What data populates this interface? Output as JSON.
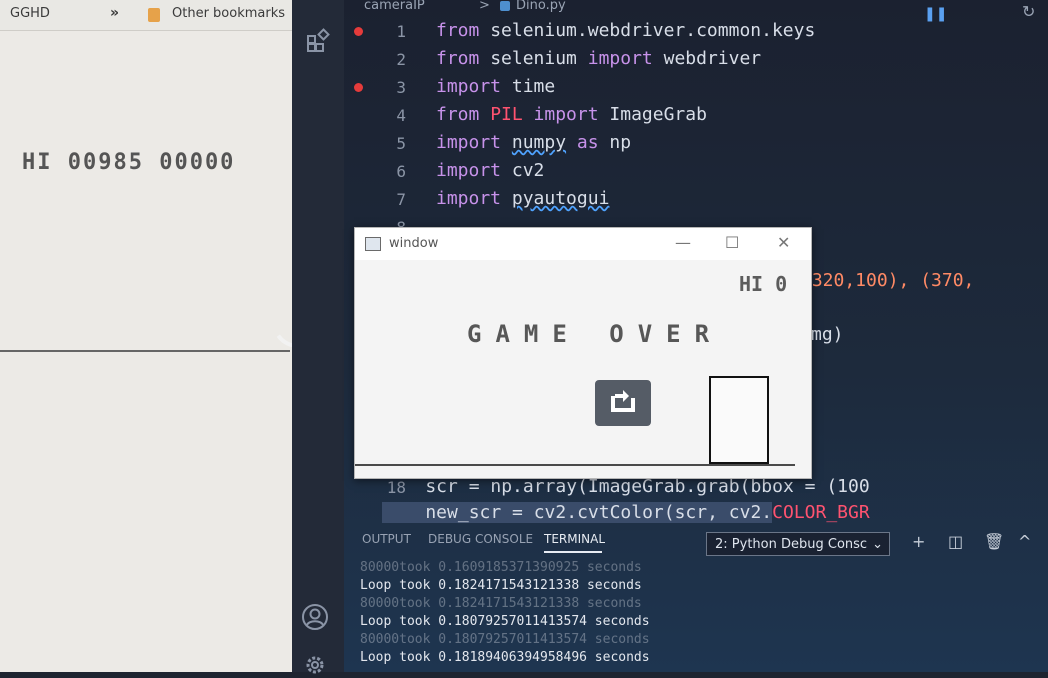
{
  "browser": {
    "bookmarks_bar": {
      "first_item": "GGHD",
      "chevron": "»",
      "other": "Other bookmarks"
    },
    "game_score": "HI 00985 00000"
  },
  "editor": {
    "breadcrumb": {
      "folder": "cameraIP",
      "separator": ">",
      "file": "Dino.py"
    },
    "code_lines": [
      {
        "n": "1",
        "breakpoint": true
      },
      {
        "n": "2",
        "breakpoint": false
      },
      {
        "n": "3",
        "breakpoint": true
      },
      {
        "n": "4",
        "breakpoint": false
      },
      {
        "n": "5",
        "breakpoint": false
      },
      {
        "n": "6",
        "breakpoint": false
      },
      {
        "n": "7",
        "breakpoint": false
      },
      {
        "n": "8",
        "breakpoint": false
      },
      {
        "n": "18",
        "breakpoint": false
      },
      {
        "n": "19",
        "breakpoint": false
      }
    ],
    "code_text": {
      "l1": {
        "kw1": "from",
        "mod": " selenium.webdriver.common.keys"
      },
      "l2": {
        "kw1": "from",
        "mod": " selenium ",
        "kw2": "import",
        "rest": " webdriver"
      },
      "l3": {
        "kw1": "import",
        "mod": " time"
      },
      "l4": {
        "kw1": "from",
        "err": " PIL ",
        "kw2": "import",
        "rest": " ImageGrab"
      },
      "l5": {
        "kw1": "import",
        "sq": "numpy",
        "kw2": " as",
        "rest": " np"
      },
      "l6": {
        "kw1": "import",
        "mod": " cv2"
      },
      "l7": {
        "kw1": "import",
        "sq": "pyautogui"
      },
      "l18": {
        "pre": "    scr = np.array(ImageGrab.grab(bbox = (100"
      },
      "l19": {
        "pre": "    new_scr = cv2.cvtColor(scr, cv2.",
        "red": "COLOR_BGR"
      }
    },
    "peek_text_1": "(320,100), (370,",
    "peek_text_2": "mg)"
  },
  "panel": {
    "tabs": [
      "OUTPUT",
      "DEBUG CONSOLE",
      "TERMINAL"
    ],
    "terminal_select": "2: Python Debug Consc",
    "terminal_lines": [
      {
        "text": "80000took 0.1609185371390925 seconds",
        "ghost": true
      },
      {
        "text": "Loop took 0.1824171543121338 seconds",
        "ghost": false
      },
      {
        "text": "80000took 0.1824171543121338 seconds",
        "ghost": true
      },
      {
        "text": "Loop took 0.18079257011413574 seconds",
        "ghost": false
      },
      {
        "text": "80000took 0.18079257011413574 seconds",
        "ghost": true
      },
      {
        "text": "Loop took 0.18189406394958496 seconds",
        "ghost": false
      }
    ]
  },
  "cv_window": {
    "title": "window",
    "hi_text": "HI 0",
    "game_over": "GAME OVER"
  }
}
